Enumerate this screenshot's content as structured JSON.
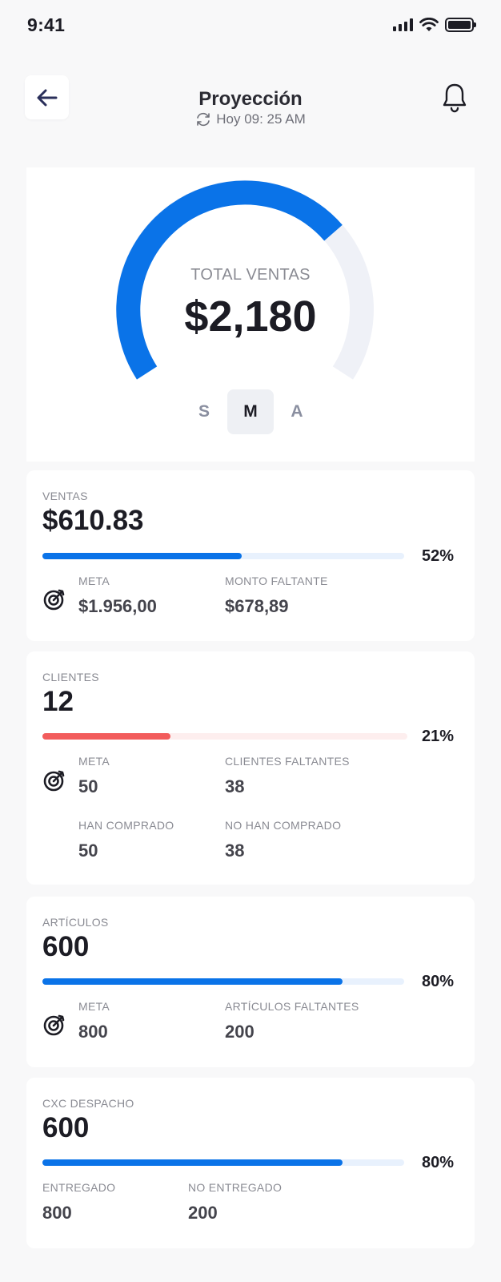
{
  "status_bar": {
    "time": "9:41"
  },
  "header": {
    "title": "Proyección",
    "subtitle": "Hoy 09: 25 AM"
  },
  "gauge": {
    "label": "TOTAL VENTAS",
    "value": "$2,180",
    "progress_fraction": 0.7,
    "colors": {
      "fill": "#0a73e8",
      "track": "#eff1f7"
    },
    "periods": [
      "S",
      "M",
      "A"
    ],
    "selected_period": "M"
  },
  "ventas": {
    "label": "VENTAS",
    "value": "$610.83",
    "percent_text": "52%",
    "progress": 0.55,
    "bar_color": "#0a73e8",
    "track_color": "#e8f1fd",
    "meta_label": "META",
    "meta_value": "$1.956,00",
    "faltante_label": "MONTO FALTANTE",
    "faltante_value": "$678,89"
  },
  "clientes": {
    "label": "CLIENTES",
    "value": "12",
    "percent_text": "21%",
    "progress": 0.35,
    "bar_color": "#f25c5c",
    "track_color": "#fdeeee",
    "meta_label": "META",
    "meta_value": "50",
    "faltantes_label": "CLIENTES FALTANTES",
    "faltantes_value": "38",
    "comprado_label": "HAN COMPRADO",
    "comprado_value": "50",
    "no_comprado_label": "NO HAN COMPRADO",
    "no_comprado_value": "38"
  },
  "articulos": {
    "label": "ARTÍCULOS",
    "value": "600",
    "percent_text": "80%",
    "progress": 0.83,
    "bar_color": "#0a73e8",
    "track_color": "#e8f1fd",
    "meta_label": "META",
    "meta_value": "800",
    "faltantes_label": "ARTÍCULOS FALTANTES",
    "faltantes_value": "200"
  },
  "cxc": {
    "label": "CXC DESPACHO",
    "value": "600",
    "percent_text": "80%",
    "progress": 0.83,
    "bar_color": "#0a73e8",
    "track_color": "#e8f1fd",
    "entregado_label": "ENTREGADO",
    "entregado_value": "800",
    "no_entregado_label": "NO ENTREGADO",
    "no_entregado_value": "200"
  },
  "icons": [
    "back-arrow-icon",
    "refresh-icon",
    "bell-icon",
    "target-icon",
    "signal-icon",
    "wifi-icon",
    "battery-icon"
  ]
}
